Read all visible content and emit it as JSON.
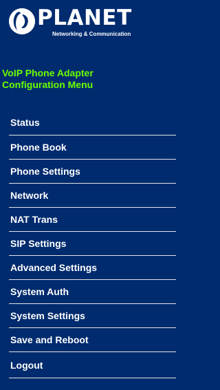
{
  "brand": {
    "name": "PLANET",
    "tagline": "Networking & Communication",
    "logo_icon": "planet-logo-icon"
  },
  "menu": {
    "title_line1": "VoIP Phone Adapter",
    "title_line2": "Configuration Menu",
    "items": [
      {
        "label": "Status"
      },
      {
        "label": "Phone Book"
      },
      {
        "label": "Phone Settings"
      },
      {
        "label": "Network"
      },
      {
        "label": "NAT Trans"
      },
      {
        "label": "SIP Settings"
      },
      {
        "label": "Advanced Settings"
      },
      {
        "label": "System Auth"
      },
      {
        "label": "System Settings"
      },
      {
        "label": "Save and Reboot"
      },
      {
        "label": "Logout"
      }
    ]
  },
  "colors": {
    "background": "#002b6e",
    "title_accent": "#6bff00",
    "menu_text": "#ffffff",
    "divider": "#e6e6e6"
  }
}
